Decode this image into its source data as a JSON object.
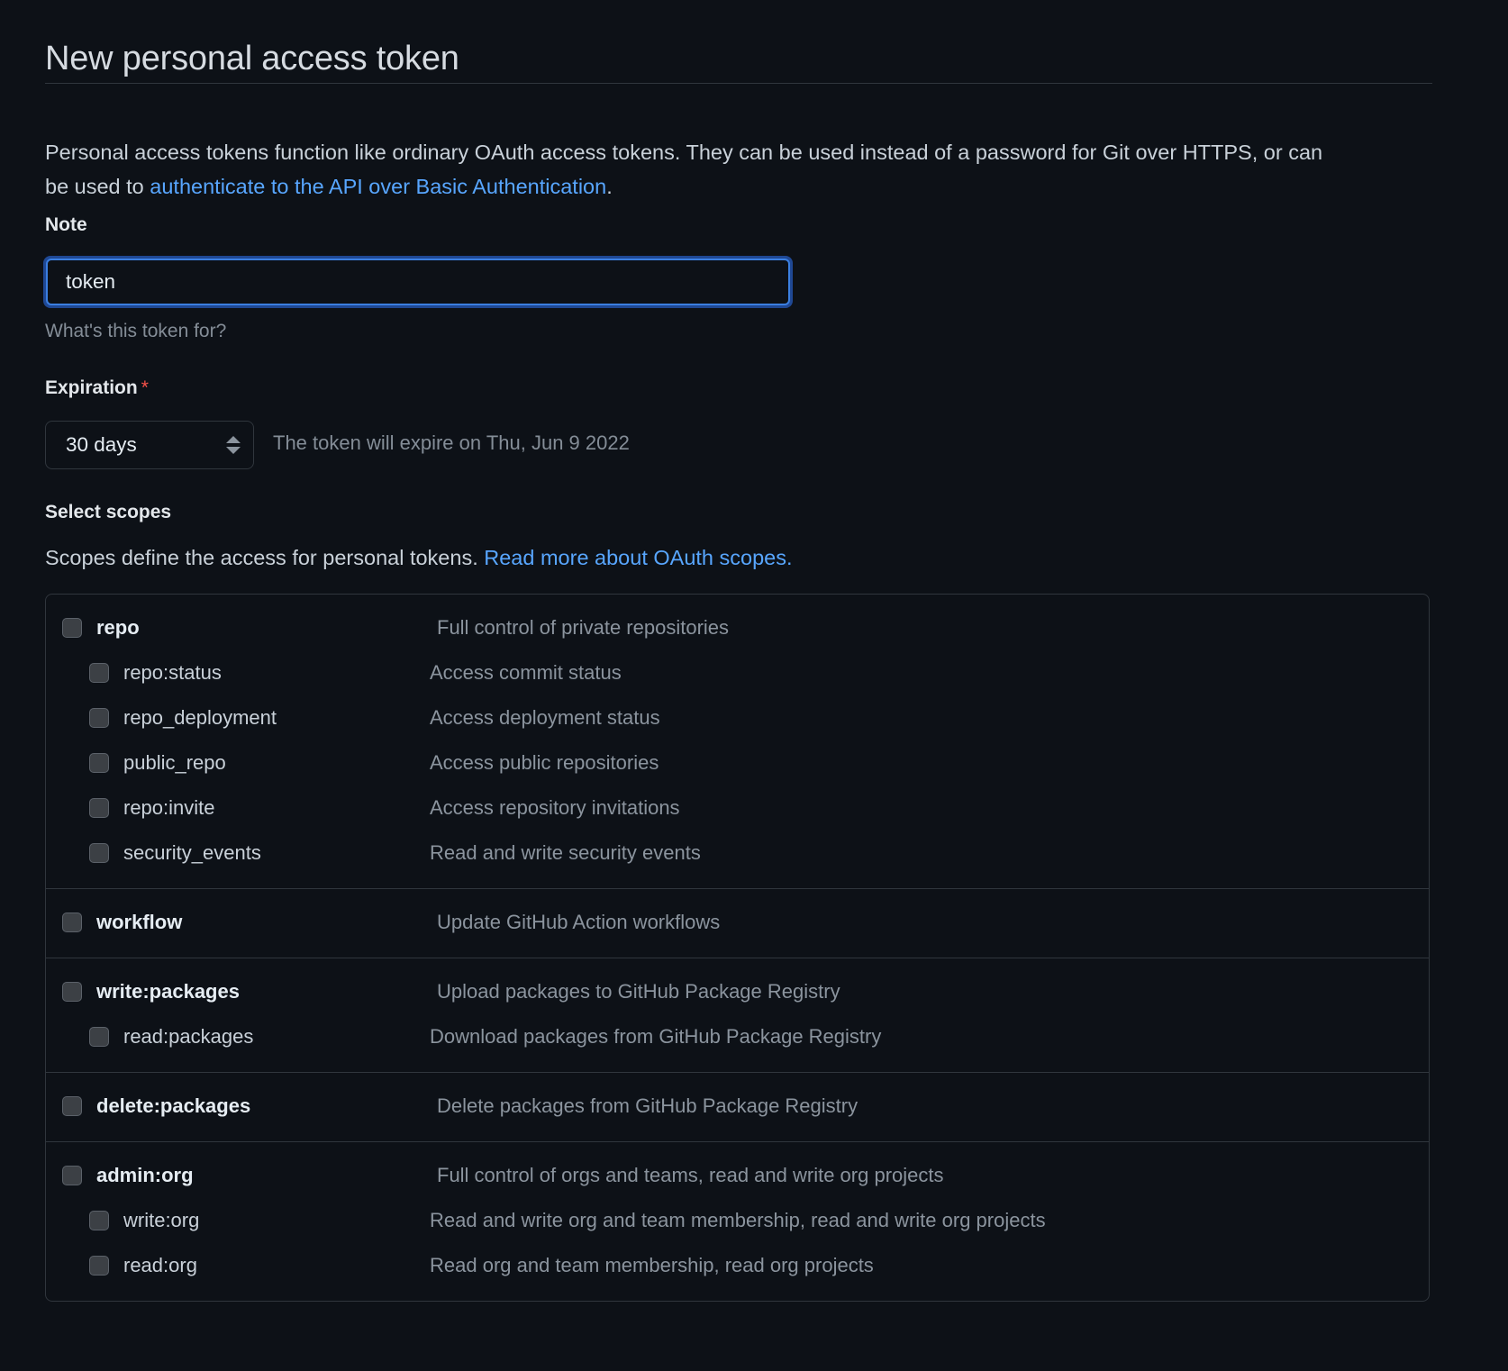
{
  "page": {
    "title": "New personal access token"
  },
  "intro": {
    "text_before": "Personal access tokens function like ordinary OAuth access tokens. They can be used instead of a password for Git over HTTPS, or can be used to ",
    "link_text": "authenticate to the API over Basic Authentication",
    "text_after": "."
  },
  "note": {
    "label": "Note",
    "value": "token",
    "placeholder": "What's this token for?",
    "help": "What's this token for?"
  },
  "expiration": {
    "label": "Expiration",
    "required_marker": "*",
    "selected": "30 days",
    "hint": "The token will expire on Thu, Jun 9 2022"
  },
  "scopes_header": {
    "title": "Select scopes",
    "description": "Scopes define the access for personal tokens. ",
    "link_text": "Read more about OAuth scopes."
  },
  "colors": {
    "background": "#0d1117",
    "border": "#30363d",
    "link": "#58a6ff",
    "text": "#c9d1d9",
    "muted": "#8b949e",
    "required": "#f85149",
    "focus_ring": "#3b7fe0",
    "checkbox_fill": "#3c4045"
  },
  "scope_groups": [
    {
      "rows": [
        {
          "level": "parent",
          "name": "repo",
          "description": "Full control of private repositories",
          "checked": false
        },
        {
          "level": "child",
          "name": "repo:status",
          "description": "Access commit status",
          "checked": false
        },
        {
          "level": "child",
          "name": "repo_deployment",
          "description": "Access deployment status",
          "checked": false
        },
        {
          "level": "child",
          "name": "public_repo",
          "description": "Access public repositories",
          "checked": false
        },
        {
          "level": "child",
          "name": "repo:invite",
          "description": "Access repository invitations",
          "checked": false
        },
        {
          "level": "child",
          "name": "security_events",
          "description": "Read and write security events",
          "checked": false
        }
      ]
    },
    {
      "rows": [
        {
          "level": "parent",
          "name": "workflow",
          "description": "Update GitHub Action workflows",
          "checked": false
        }
      ]
    },
    {
      "rows": [
        {
          "level": "parent",
          "name": "write:packages",
          "description": "Upload packages to GitHub Package Registry",
          "checked": false
        },
        {
          "level": "child",
          "name": "read:packages",
          "description": "Download packages from GitHub Package Registry",
          "checked": false
        }
      ]
    },
    {
      "rows": [
        {
          "level": "parent",
          "name": "delete:packages",
          "description": "Delete packages from GitHub Package Registry",
          "checked": false
        }
      ]
    },
    {
      "rows": [
        {
          "level": "parent",
          "name": "admin:org",
          "description": "Full control of orgs and teams, read and write org projects",
          "checked": false
        },
        {
          "level": "child",
          "name": "write:org",
          "description": "Read and write org and team membership, read and write org projects",
          "checked": false
        },
        {
          "level": "child",
          "name": "read:org",
          "description": "Read org and team membership, read org projects",
          "checked": false
        }
      ]
    }
  ]
}
